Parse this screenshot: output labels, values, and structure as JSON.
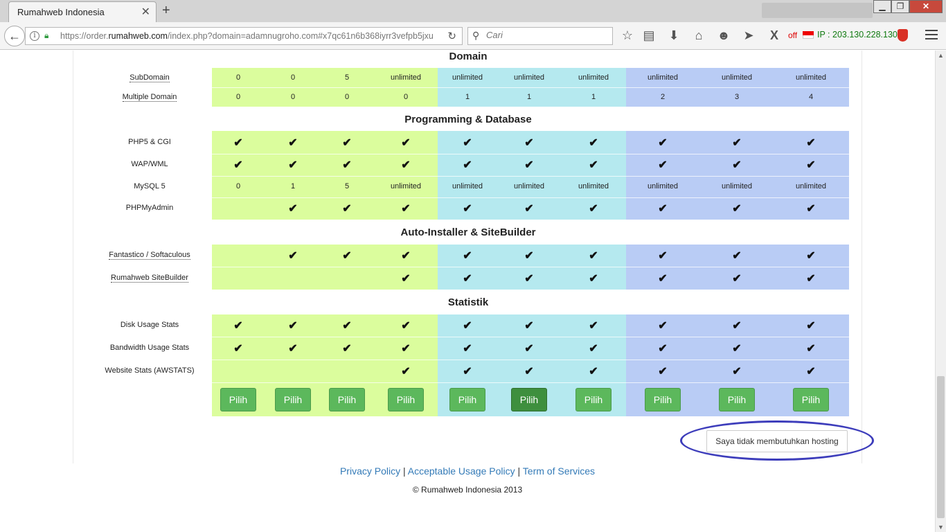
{
  "browser": {
    "tab_title": "Rumahweb Indonesia",
    "tab_close": "✕",
    "new_tab": "+",
    "url_prefix": "https://order.",
    "url_domain": "rumahweb.com",
    "url_rest": "/index.php?domain=adamnugroho.com#x7qc61n6b368iyrr3vefpb5jxu",
    "search_placeholder": "Cari",
    "ext_off": "off",
    "ip_text": "IP : 203.130.228.130",
    "win_min": "▁",
    "win_max": "❐",
    "win_close": "✕"
  },
  "icons": {
    "back": "back-arrow-icon",
    "info": "info-icon",
    "lock": "lock-icon",
    "reload": "reload-icon",
    "search": "search-icon",
    "bookmark": "star-icon",
    "reading_list": "clipboard-icon",
    "download": "download-icon",
    "home": "home-icon",
    "chat": "chat-icon",
    "send": "send-icon",
    "x_ext": "x-extension-icon",
    "flag": "indonesia-flag-icon",
    "shield": "shield-icon",
    "menu": "hamburger-menu-icon"
  },
  "colors": {
    "green_tier": "#dbfd9d",
    "teal_tier": "#b5e9ef",
    "blue_tier": "#b9ccf5",
    "button_green": "#5cb85c",
    "button_active": "#3e8f3e",
    "annotation": "#3d3dbb",
    "link": "#337ab7"
  },
  "check_mark": "✔",
  "sections": {
    "domain": "Domain",
    "programming": "Programming & Database",
    "autoinstaller": "Auto-Installer & SiteBuilder",
    "statistik": "Statistik"
  },
  "rows": {
    "subdomain": {
      "label": "SubDomain",
      "values": [
        "0",
        "0",
        "5",
        "unlimited",
        "unlimited",
        "unlimited",
        "unlimited",
        "unlimited",
        "unlimited",
        "unlimited"
      ]
    },
    "multiple_domain": {
      "label": "Multiple Domain",
      "values": [
        "0",
        "0",
        "0",
        "0",
        "1",
        "1",
        "1",
        "2",
        "3",
        "4"
      ]
    },
    "php5": {
      "label": "PHP5 & CGI",
      "checks": [
        true,
        true,
        true,
        true,
        true,
        true,
        true,
        true,
        true,
        true
      ]
    },
    "wap": {
      "label": "WAP/WML",
      "checks": [
        true,
        true,
        true,
        true,
        true,
        true,
        true,
        true,
        true,
        true
      ]
    },
    "mysql": {
      "label": "MySQL 5",
      "values": [
        "0",
        "1",
        "5",
        "unlimited",
        "unlimited",
        "unlimited",
        "unlimited",
        "unlimited",
        "unlimited",
        "unlimited"
      ]
    },
    "phpmyadmin": {
      "label": "PHPMyAdmin",
      "checks": [
        false,
        true,
        true,
        true,
        true,
        true,
        true,
        true,
        true,
        true
      ]
    },
    "fantastico": {
      "label": "Fantastico / Softaculous",
      "checks": [
        false,
        true,
        true,
        true,
        true,
        true,
        true,
        true,
        true,
        true
      ]
    },
    "sitebuilder": {
      "label": "Rumahweb SiteBuilder",
      "checks": [
        false,
        false,
        false,
        true,
        true,
        true,
        true,
        true,
        true,
        true
      ]
    },
    "disk_stats": {
      "label": "Disk Usage Stats",
      "checks": [
        true,
        true,
        true,
        true,
        true,
        true,
        true,
        true,
        true,
        true
      ]
    },
    "bandwidth_stats": {
      "label": "Bandwidth Usage Stats",
      "checks": [
        true,
        true,
        true,
        true,
        true,
        true,
        true,
        true,
        true,
        true
      ]
    },
    "awstats": {
      "label": "Website Stats (AWSTATS)",
      "checks": [
        false,
        false,
        false,
        true,
        true,
        true,
        true,
        true,
        true,
        true
      ]
    }
  },
  "pilih": {
    "label": "Pilih",
    "active_index": 5
  },
  "no_hosting_button": "Saya tidak membutuhkan hosting",
  "footer": {
    "privacy": "Privacy Policy",
    "acceptable": "Acceptable Usage Policy",
    "terms": "Term of Services",
    "separator": " | ",
    "copyright": "© Rumahweb Indonesia 2013"
  }
}
